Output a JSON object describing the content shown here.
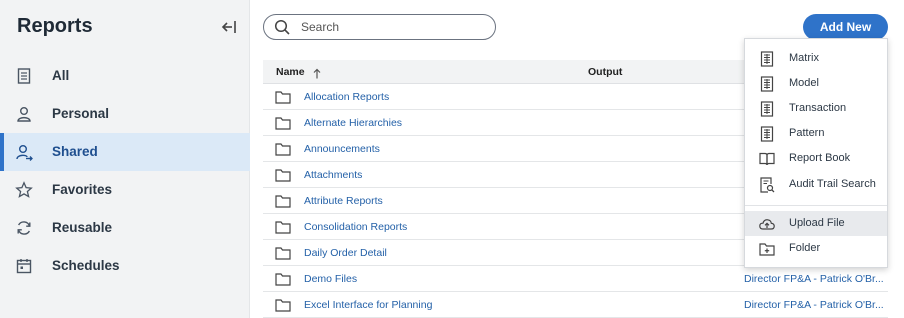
{
  "sidebar": {
    "title": "Reports",
    "items": [
      {
        "label": "All",
        "icon": "document-icon"
      },
      {
        "label": "Personal",
        "icon": "person-icon"
      },
      {
        "label": "Shared",
        "icon": "shared-person-icon",
        "active": true
      },
      {
        "label": "Favorites",
        "icon": "star-icon"
      },
      {
        "label": "Reusable",
        "icon": "refresh-icon"
      },
      {
        "label": "Schedules",
        "icon": "calendar-icon"
      }
    ]
  },
  "search": {
    "placeholder": "Search",
    "value": ""
  },
  "toolbar": {
    "add_label": "Add New"
  },
  "table": {
    "columns": {
      "name": "Name",
      "output": "Output"
    },
    "rows": [
      {
        "name": "Allocation Reports",
        "output": ""
      },
      {
        "name": "Alternate Hierarchies",
        "output": ""
      },
      {
        "name": "Announcements",
        "output": ""
      },
      {
        "name": "Attachments",
        "output": ""
      },
      {
        "name": "Attribute Reports",
        "output": ""
      },
      {
        "name": "Consolidation Reports",
        "output": ""
      },
      {
        "name": "Daily Order Detail",
        "output": ""
      },
      {
        "name": "Demo Files",
        "output": "Director FP&A - Patrick O'Br..."
      },
      {
        "name": "Excel Interface for Planning",
        "output": "Director FP&A - Patrick O'Br..."
      }
    ]
  },
  "menu": {
    "items": [
      {
        "label": "Matrix",
        "icon": "grid-doc-icon"
      },
      {
        "label": "Model",
        "icon": "grid-doc-icon"
      },
      {
        "label": "Transaction",
        "icon": "grid-doc-icon"
      },
      {
        "label": "Pattern",
        "icon": "grid-doc-icon"
      },
      {
        "label": "Report Book",
        "icon": "book-icon"
      },
      {
        "label": "Audit Trail Search",
        "icon": "doc-search-icon"
      },
      {
        "label": "Upload File",
        "icon": "cloud-upload-icon",
        "hover": true
      },
      {
        "label": "Folder",
        "icon": "folder-plus-icon"
      }
    ]
  },
  "colors": {
    "accent": "#2f73c9",
    "link": "#2461a8",
    "active_bg": "#dbe9f7",
    "sidebar_bg": "#f2f3f4"
  }
}
